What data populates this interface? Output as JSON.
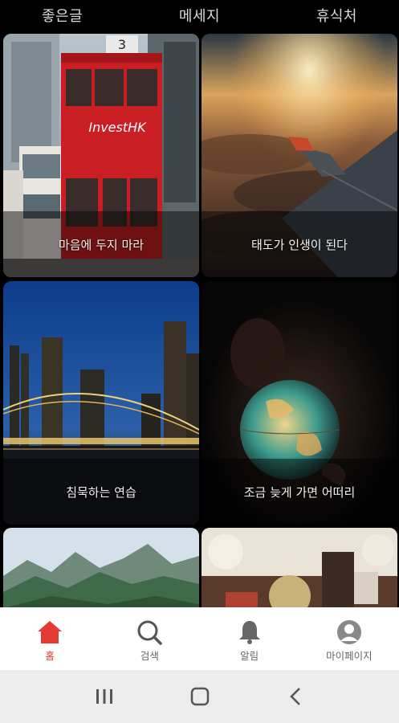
{
  "top_tabs": [
    {
      "label": "좋은글"
    },
    {
      "label": "메세지"
    },
    {
      "label": "휴식처"
    }
  ],
  "cards": [
    {
      "caption": "마음에 두지 마라"
    },
    {
      "caption": "태도가 인생이 된다"
    },
    {
      "caption": "침묵하는 연습"
    },
    {
      "caption": "조금 늦게 가면 어떠리"
    },
    {
      "caption": ""
    },
    {
      "caption": ""
    }
  ],
  "bus_sign": {
    "text": "InvestHK",
    "number": "3"
  },
  "bottom_nav": [
    {
      "label": "홈",
      "icon": "home-icon",
      "active": true
    },
    {
      "label": "검색",
      "icon": "search-icon",
      "active": false
    },
    {
      "label": "알림",
      "icon": "bell-icon",
      "active": false
    },
    {
      "label": "마이페이지",
      "icon": "profile-icon",
      "active": false
    }
  ],
  "colors": {
    "accent": "#e33b33",
    "nav_inactive": "#666666"
  }
}
